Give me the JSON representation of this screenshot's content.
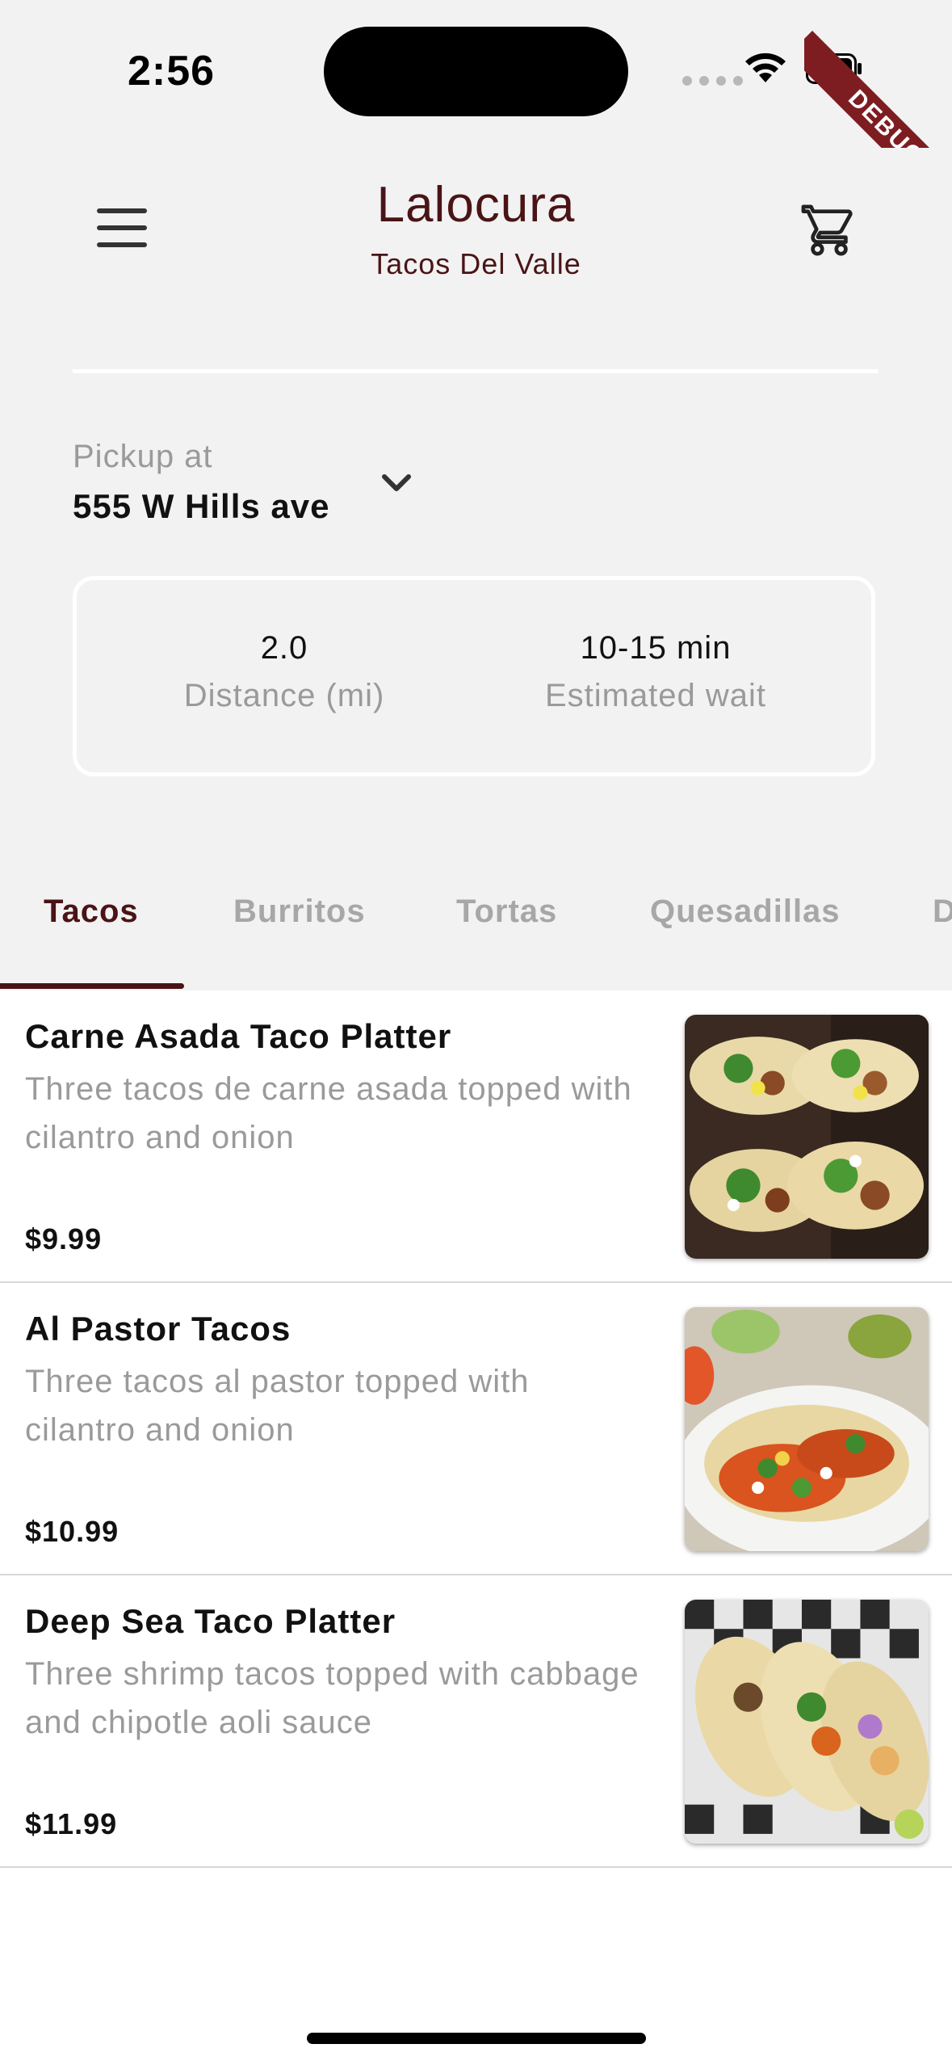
{
  "status_bar": {
    "time": "2:56"
  },
  "debug_banner": "DEBUG",
  "header": {
    "title": "Lalocura",
    "subtitle": "Tacos Del Valle"
  },
  "pickup": {
    "label": "Pickup at",
    "address": "555 W Hills ave"
  },
  "stats": [
    {
      "value": "2.0",
      "label": "Distance (mi)"
    },
    {
      "value": "10-15 min",
      "label": "Estimated wait"
    }
  ],
  "tabs": [
    {
      "label": "Tacos",
      "active": true
    },
    {
      "label": "Burritos"
    },
    {
      "label": "Tortas"
    },
    {
      "label": "Quesadillas"
    },
    {
      "label": "D"
    }
  ],
  "menu_items": [
    {
      "name": "Carne Asada Taco Platter",
      "description": "Three tacos de carne asada topped with cilantro and onion",
      "price": "$9.99"
    },
    {
      "name": "Al Pastor Tacos",
      "description": "Three tacos al pastor topped with cilantro and onion",
      "price": "$10.99"
    },
    {
      "name": "Deep Sea Taco Platter",
      "description": "Three shrimp tacos topped with cabbage and chipotle aoli sauce",
      "price": "$11.99"
    }
  ],
  "colors": {
    "brand": "#4a1416",
    "background": "#f2f2f2",
    "muted_text": "#9a9a9a",
    "debug_ribbon": "#7d1d21"
  },
  "icons": [
    "menu-icon",
    "cart-icon",
    "chevron-down-icon",
    "wifi-icon",
    "battery-icon"
  ]
}
